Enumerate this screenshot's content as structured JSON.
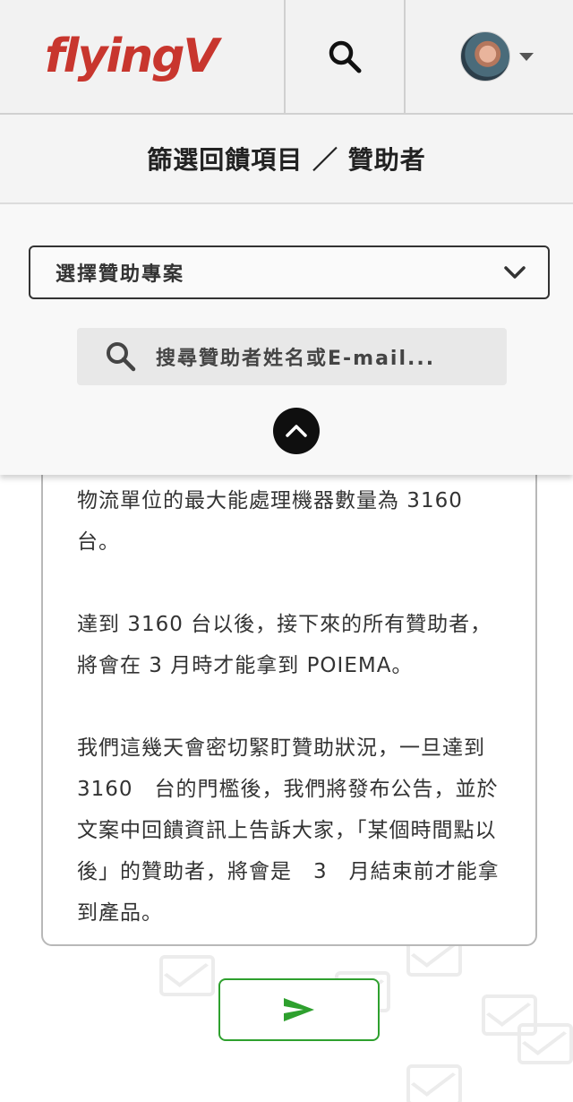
{
  "brand": {
    "logo_text": "flyingV",
    "logo_color": "#c8362e"
  },
  "filter": {
    "title": "篩選回饋項目 ／ 贊助者",
    "select_label": "選擇贊助專案",
    "search_placeholder": "搜尋贊助者姓名或E-mail..."
  },
  "content": {
    "paragraphs": [
      "物流單位的最大能處理機器數量為 3160 台。",
      "達到 3160 台以後，接下來的所有贊助者，將會在 3 月時才能拿到 POIEMA。",
      "我們這幾天會密切緊盯贊助狀況，一旦達到 3160　台的門檻後，我們將發布公告，並於文案中回饋資訊上告訴大家，「某個時間點以後」的贊助者，將會是　3　月結束前才能拿到產品。"
    ]
  },
  "icons": {
    "search": "search-icon",
    "caret": "caret-down-icon",
    "chevron_down": "chevron-down-icon",
    "chevron_up": "chevron-up-icon",
    "send": "send-icon",
    "envelope": "envelope-icon"
  },
  "colors": {
    "accent_green": "#2ea02e",
    "brand_red": "#c8362e"
  }
}
